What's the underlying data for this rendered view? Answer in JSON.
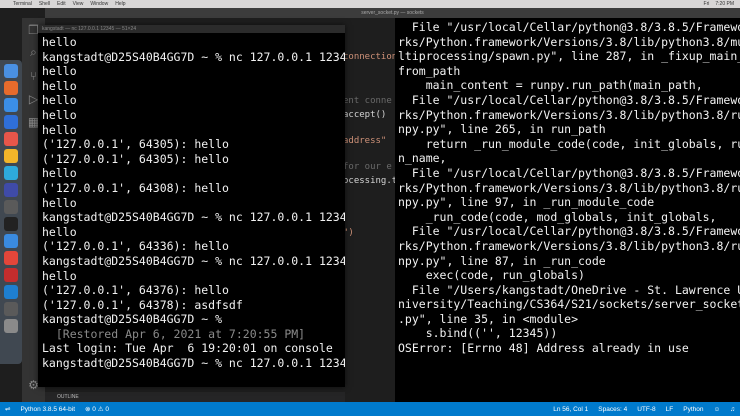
{
  "menubar": {
    "items": [
      "Terminal",
      "Shell",
      "Edit",
      "View",
      "Window",
      "Help"
    ],
    "right": [
      "Fri",
      "7:20 PM"
    ]
  },
  "window": {
    "vscode_title": "server_socket.py — sockets",
    "term1_title": "kangstadt — nc 127.0.0.1 12345 — 51×24"
  },
  "terminal_left": {
    "lines": [
      "hello",
      "kangstadt@D25S40B4GG7D ~ % nc 127.0.0.1 12345",
      "hello",
      "hello",
      "hello",
      "hello",
      "hello",
      "('127.0.0.1', 64305): hello",
      "('127.0.0.1', 64305): hello",
      "hello",
      "('127.0.0.1', 64308): hello",
      "hello",
      "kangstadt@D25S40B4GG7D ~ % nc 127.0.0.1 12345",
      "hello",
      "('127.0.0.1', 64336): hello",
      "kangstadt@D25S40B4GG7D ~ % nc 127.0.0.1 12345",
      "hello",
      "('127.0.0.1', 64376): hello",
      "('127.0.0.1', 64378): asdfsdf",
      "kangstadt@D25S40B4GG7D ~ %",
      "  [Restored Apr 6, 2021 at 7:20:55 PM]",
      "Last login: Tue Apr  6 19:20:01 on console",
      "kangstadt@D25S40B4GG7D ~ % nc 127.0.0.1 12345"
    ]
  },
  "terminal_right": {
    "lines": [
      "  File \"/usr/local/Cellar/python@3.8/3.8.5/Framewo",
      "rks/Python.framework/Versions/3.8/lib/python3.8/mu",
      "ltiprocessing/spawn.py\", line 287, in _fixup_main_",
      "from_path",
      "    main_content = runpy.run_path(main_path,",
      "  File \"/usr/local/Cellar/python@3.8/3.8.5/Framewo",
      "rks/Python.framework/Versions/3.8/lib/python3.8/ru",
      "npy.py\", line 265, in run_path",
      "    return _run_module_code(code, init_globals, ru",
      "n_name,",
      "  File \"/usr/local/Cellar/python@3.8/3.8.5/Framewo",
      "rks/Python.framework/Versions/3.8/lib/python3.8/ru",
      "npy.py\", line 97, in _run_module_code",
      "    _run_code(code, mod_globals, init_globals,",
      "  File \"/usr/local/Cellar/python@3.8/3.8.5/Framewo",
      "rks/Python.framework/Versions/3.8/lib/python3.8/ru",
      "npy.py\", line 87, in _run_code",
      "    exec(code, run_globals)",
      "  File \"/Users/kangstadt/OneDrive - St. Lawrence U",
      "niversity/Teaching/CS364/S21/sockets/server_socket",
      ".py\", line 35, in <module>",
      "    s.bind(('', 12345))",
      "OSError: [Errno 48] Address already in use"
    ]
  },
  "editor_fragments": {
    "f1": "connection",
    "f2": "ent conne",
    "f3": "accept()",
    "f4": "address\"",
    "f5": "for our e",
    "f6": "ocessing.t",
    "f7": "\")"
  },
  "outline": {
    "label": "OUTLINE"
  },
  "status": {
    "python": "Python 3.8.5 64-bit",
    "problems": "⊗ 0  ⚠ 0",
    "position": "Ln 56, Col 1",
    "spaces": "Spaces: 4",
    "encoding": "UTF-8",
    "eol": "LF",
    "language": "Python"
  },
  "colors": {
    "status_bar": "#007acc",
    "terminal_bg": "#000000",
    "terminal_fg": "#f2f2f2"
  }
}
